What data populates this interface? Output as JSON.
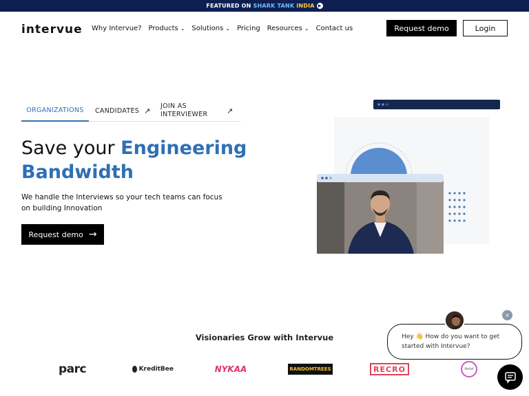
{
  "banner": {
    "featured": "FEATURED ON",
    "shark": "SHARK TANK",
    "india": "INDIA"
  },
  "nav": {
    "logo": "intervue",
    "items": [
      {
        "label": "Why Intervue?",
        "dropdown": false
      },
      {
        "label": "Products",
        "dropdown": true
      },
      {
        "label": "Solutions",
        "dropdown": true
      },
      {
        "label": "Pricing",
        "dropdown": false
      },
      {
        "label": "Resources",
        "dropdown": true
      },
      {
        "label": "Contact us",
        "dropdown": false
      }
    ],
    "request_demo": "Request demo",
    "login": "Login"
  },
  "hero": {
    "tabs": [
      {
        "label": "ORGANIZATIONS",
        "active": true
      },
      {
        "label": "CANDIDATES",
        "active": false
      },
      {
        "label": "JOIN AS INTERVIEWER",
        "active": false
      }
    ],
    "title_plain": "Save your ",
    "title_highlight": "Engineering Bandwidth",
    "description": "We handle the Interviews so your tech teams can focus on building Innovation",
    "cta": "Request demo"
  },
  "visionaries": {
    "title": "Visionaries Grow with Intervue",
    "logos": [
      "parc",
      "KreditBee",
      "NYKAA",
      "RANDOMTREES",
      "RECRO",
      "Antal"
    ]
  },
  "chat": {
    "message": "Hey 👋 How do you want to get started with Intervue?",
    "close": "×"
  },
  "colors": {
    "accent": "#2f6fb5",
    "banner": "#0e1f52",
    "dark": "#000000"
  }
}
